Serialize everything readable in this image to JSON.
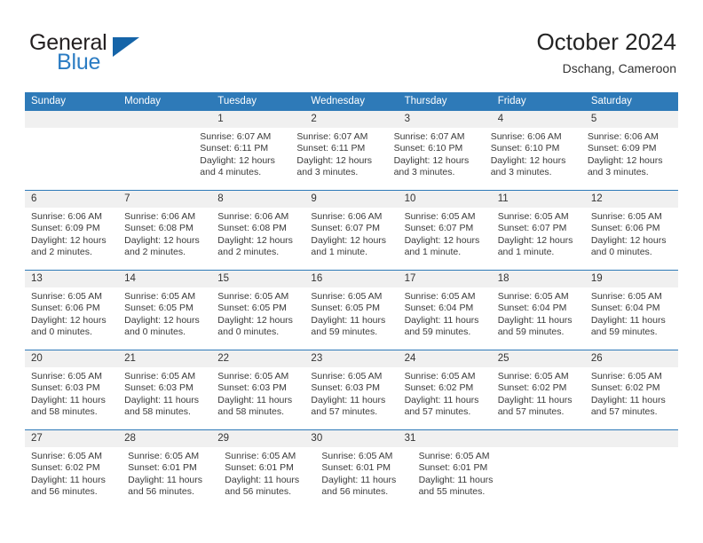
{
  "brand": {
    "name_top": "General",
    "name_bottom": "Blue",
    "triangle_color": "#1564a8",
    "blue_color": "#2b7cc3"
  },
  "header": {
    "title": "October 2024",
    "subtitle": "Dschang, Cameroon"
  },
  "theme": {
    "header_blue": "#2e7ab8",
    "daynum_bg": "#f0f0f0",
    "text": "#333333"
  },
  "weekdays": [
    "Sunday",
    "Monday",
    "Tuesday",
    "Wednesday",
    "Thursday",
    "Friday",
    "Saturday"
  ],
  "weeks": [
    {
      "days": [
        {
          "num": "",
          "sunrise": "",
          "sunset": "",
          "daylight_1": "",
          "daylight_2": ""
        },
        {
          "num": "",
          "sunrise": "",
          "sunset": "",
          "daylight_1": "",
          "daylight_2": ""
        },
        {
          "num": "1",
          "sunrise": "Sunrise: 6:07 AM",
          "sunset": "Sunset: 6:11 PM",
          "daylight_1": "Daylight: 12 hours",
          "daylight_2": "and 4 minutes."
        },
        {
          "num": "2",
          "sunrise": "Sunrise: 6:07 AM",
          "sunset": "Sunset: 6:11 PM",
          "daylight_1": "Daylight: 12 hours",
          "daylight_2": "and 3 minutes."
        },
        {
          "num": "3",
          "sunrise": "Sunrise: 6:07 AM",
          "sunset": "Sunset: 6:10 PM",
          "daylight_1": "Daylight: 12 hours",
          "daylight_2": "and 3 minutes."
        },
        {
          "num": "4",
          "sunrise": "Sunrise: 6:06 AM",
          "sunset": "Sunset: 6:10 PM",
          "daylight_1": "Daylight: 12 hours",
          "daylight_2": "and 3 minutes."
        },
        {
          "num": "5",
          "sunrise": "Sunrise: 6:06 AM",
          "sunset": "Sunset: 6:09 PM",
          "daylight_1": "Daylight: 12 hours",
          "daylight_2": "and 3 minutes."
        }
      ]
    },
    {
      "days": [
        {
          "num": "6",
          "sunrise": "Sunrise: 6:06 AM",
          "sunset": "Sunset: 6:09 PM",
          "daylight_1": "Daylight: 12 hours",
          "daylight_2": "and 2 minutes."
        },
        {
          "num": "7",
          "sunrise": "Sunrise: 6:06 AM",
          "sunset": "Sunset: 6:08 PM",
          "daylight_1": "Daylight: 12 hours",
          "daylight_2": "and 2 minutes."
        },
        {
          "num": "8",
          "sunrise": "Sunrise: 6:06 AM",
          "sunset": "Sunset: 6:08 PM",
          "daylight_1": "Daylight: 12 hours",
          "daylight_2": "and 2 minutes."
        },
        {
          "num": "9",
          "sunrise": "Sunrise: 6:06 AM",
          "sunset": "Sunset: 6:07 PM",
          "daylight_1": "Daylight: 12 hours",
          "daylight_2": "and 1 minute."
        },
        {
          "num": "10",
          "sunrise": "Sunrise: 6:05 AM",
          "sunset": "Sunset: 6:07 PM",
          "daylight_1": "Daylight: 12 hours",
          "daylight_2": "and 1 minute."
        },
        {
          "num": "11",
          "sunrise": "Sunrise: 6:05 AM",
          "sunset": "Sunset: 6:07 PM",
          "daylight_1": "Daylight: 12 hours",
          "daylight_2": "and 1 minute."
        },
        {
          "num": "12",
          "sunrise": "Sunrise: 6:05 AM",
          "sunset": "Sunset: 6:06 PM",
          "daylight_1": "Daylight: 12 hours",
          "daylight_2": "and 0 minutes."
        }
      ]
    },
    {
      "days": [
        {
          "num": "13",
          "sunrise": "Sunrise: 6:05 AM",
          "sunset": "Sunset: 6:06 PM",
          "daylight_1": "Daylight: 12 hours",
          "daylight_2": "and 0 minutes."
        },
        {
          "num": "14",
          "sunrise": "Sunrise: 6:05 AM",
          "sunset": "Sunset: 6:05 PM",
          "daylight_1": "Daylight: 12 hours",
          "daylight_2": "and 0 minutes."
        },
        {
          "num": "15",
          "sunrise": "Sunrise: 6:05 AM",
          "sunset": "Sunset: 6:05 PM",
          "daylight_1": "Daylight: 12 hours",
          "daylight_2": "and 0 minutes."
        },
        {
          "num": "16",
          "sunrise": "Sunrise: 6:05 AM",
          "sunset": "Sunset: 6:05 PM",
          "daylight_1": "Daylight: 11 hours",
          "daylight_2": "and 59 minutes."
        },
        {
          "num": "17",
          "sunrise": "Sunrise: 6:05 AM",
          "sunset": "Sunset: 6:04 PM",
          "daylight_1": "Daylight: 11 hours",
          "daylight_2": "and 59 minutes."
        },
        {
          "num": "18",
          "sunrise": "Sunrise: 6:05 AM",
          "sunset": "Sunset: 6:04 PM",
          "daylight_1": "Daylight: 11 hours",
          "daylight_2": "and 59 minutes."
        },
        {
          "num": "19",
          "sunrise": "Sunrise: 6:05 AM",
          "sunset": "Sunset: 6:04 PM",
          "daylight_1": "Daylight: 11 hours",
          "daylight_2": "and 59 minutes."
        }
      ]
    },
    {
      "days": [
        {
          "num": "20",
          "sunrise": "Sunrise: 6:05 AM",
          "sunset": "Sunset: 6:03 PM",
          "daylight_1": "Daylight: 11 hours",
          "daylight_2": "and 58 minutes."
        },
        {
          "num": "21",
          "sunrise": "Sunrise: 6:05 AM",
          "sunset": "Sunset: 6:03 PM",
          "daylight_1": "Daylight: 11 hours",
          "daylight_2": "and 58 minutes."
        },
        {
          "num": "22",
          "sunrise": "Sunrise: 6:05 AM",
          "sunset": "Sunset: 6:03 PM",
          "daylight_1": "Daylight: 11 hours",
          "daylight_2": "and 58 minutes."
        },
        {
          "num": "23",
          "sunrise": "Sunrise: 6:05 AM",
          "sunset": "Sunset: 6:03 PM",
          "daylight_1": "Daylight: 11 hours",
          "daylight_2": "and 57 minutes."
        },
        {
          "num": "24",
          "sunrise": "Sunrise: 6:05 AM",
          "sunset": "Sunset: 6:02 PM",
          "daylight_1": "Daylight: 11 hours",
          "daylight_2": "and 57 minutes."
        },
        {
          "num": "25",
          "sunrise": "Sunrise: 6:05 AM",
          "sunset": "Sunset: 6:02 PM",
          "daylight_1": "Daylight: 11 hours",
          "daylight_2": "and 57 minutes."
        },
        {
          "num": "26",
          "sunrise": "Sunrise: 6:05 AM",
          "sunset": "Sunset: 6:02 PM",
          "daylight_1": "Daylight: 11 hours",
          "daylight_2": "and 57 minutes."
        }
      ]
    },
    {
      "days": [
        {
          "num": "27",
          "sunrise": "Sunrise: 6:05 AM",
          "sunset": "Sunset: 6:02 PM",
          "daylight_1": "Daylight: 11 hours",
          "daylight_2": "and 56 minutes."
        },
        {
          "num": "28",
          "sunrise": "Sunrise: 6:05 AM",
          "sunset": "Sunset: 6:01 PM",
          "daylight_1": "Daylight: 11 hours",
          "daylight_2": "and 56 minutes."
        },
        {
          "num": "29",
          "sunrise": "Sunrise: 6:05 AM",
          "sunset": "Sunset: 6:01 PM",
          "daylight_1": "Daylight: 11 hours",
          "daylight_2": "and 56 minutes."
        },
        {
          "num": "30",
          "sunrise": "Sunrise: 6:05 AM",
          "sunset": "Sunset: 6:01 PM",
          "daylight_1": "Daylight: 11 hours",
          "daylight_2": "and 56 minutes."
        },
        {
          "num": "31",
          "sunrise": "Sunrise: 6:05 AM",
          "sunset": "Sunset: 6:01 PM",
          "daylight_1": "Daylight: 11 hours",
          "daylight_2": "and 55 minutes."
        },
        {
          "num": "",
          "sunrise": "",
          "sunset": "",
          "daylight_1": "",
          "daylight_2": ""
        },
        {
          "num": "",
          "sunrise": "",
          "sunset": "",
          "daylight_1": "",
          "daylight_2": ""
        }
      ]
    }
  ]
}
